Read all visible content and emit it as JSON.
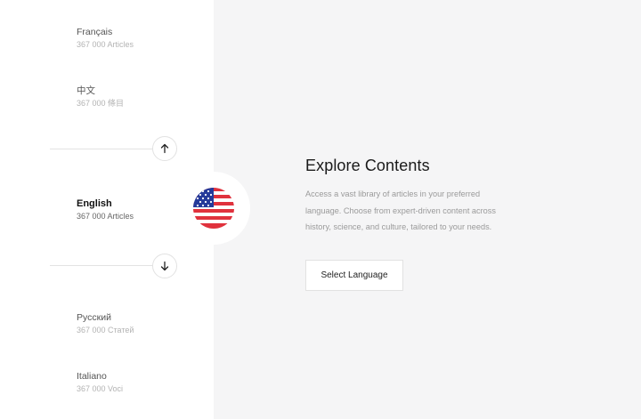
{
  "languages": [
    {
      "name": "Français",
      "count": "367 000 Articles"
    },
    {
      "name": "中文",
      "count": "367 000 條目"
    },
    {
      "name": "English",
      "count": "367 000 Articles"
    },
    {
      "name": "Русский",
      "count": "367 000 Статей"
    },
    {
      "name": "Italiano",
      "count": "367 000 Voci"
    }
  ],
  "active_language_index": 2,
  "active_flag_icon": "us-flag-icon",
  "nav": {
    "up_icon": "arrow-up-icon",
    "down_icon": "arrow-down-icon"
  },
  "main": {
    "title": "Explore Contents",
    "description": "Access a vast library of articles in your preferred language. Choose from expert-driven content across history, science, and culture, tailored to your needs.",
    "select_button": "Select Language"
  },
  "colors": {
    "flag_red": "#e0323d",
    "flag_blue": "#253a9a",
    "background": "#f5f5f6",
    "sidebar": "#ffffff"
  }
}
